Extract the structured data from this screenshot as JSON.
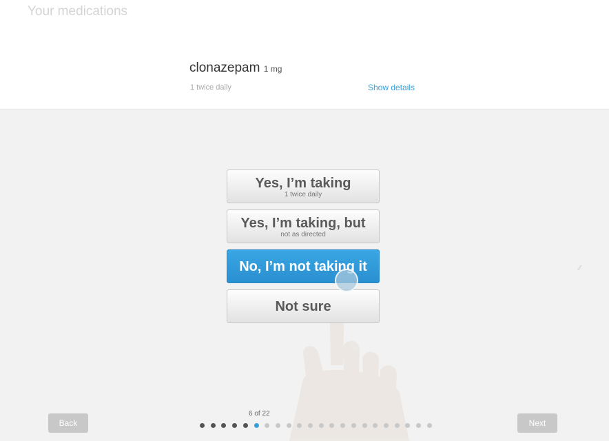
{
  "header": {
    "title": "Your medications"
  },
  "medication": {
    "name": "clonazepam",
    "dose": "1 mg",
    "frequency": "1 twice daily",
    "details_link": "Show details"
  },
  "answers": [
    {
      "label": "Yes, I’m taking",
      "sub": "1 twice daily",
      "selected": false
    },
    {
      "label": "Yes, I’m taking, but",
      "sub": "not as directed",
      "selected": false
    },
    {
      "label": "No, I’m not taking it",
      "sub": "",
      "selected": true
    },
    {
      "label": "Not sure",
      "sub": "",
      "selected": false
    }
  ],
  "navigation": {
    "back_label": "Back",
    "next_label": "Next"
  },
  "progress": {
    "label": "6 of 22",
    "current": 6,
    "total": 22
  },
  "colors": {
    "accent": "#3aa0d8",
    "dot_done": "#555555",
    "dot_current": "#3aa0d8",
    "dot_pending": "#c8c8c8"
  }
}
